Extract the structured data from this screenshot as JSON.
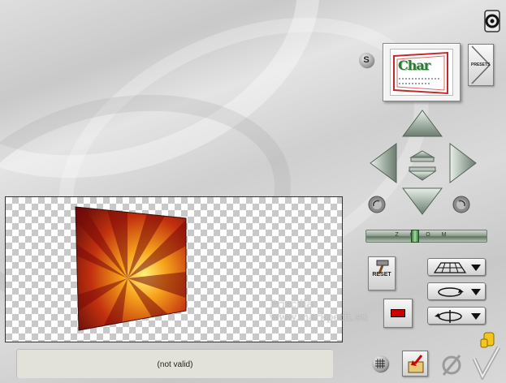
{
  "icons": {
    "help": "question-icon",
    "s_button": "S",
    "preset_thumbnail": "Char",
    "presets_label": "PRESETS",
    "nav_up": "arrow-up-icon",
    "nav_down": "arrow-down-icon",
    "nav_left": "arrow-left-icon",
    "nav_right": "arrow-right-icon",
    "rotate_left": "rotate-left-icon",
    "rotate_right": "rotate-right-icon",
    "grid": "grid-icon",
    "export": "export-icon",
    "cancel": "cancel-icon",
    "ok": "ok-checkmark-icon"
  },
  "zoom": {
    "label": "ZOOM",
    "level": 0.4
  },
  "reset_label": "RESET",
  "status": {
    "text": "(not valid)"
  },
  "watermark": {
    "line1": "Priscilla",
    "line2": "www.markpetit.eu"
  },
  "colors": {
    "accent_red": "#c00000",
    "slider_green": "#3d7a3d"
  }
}
